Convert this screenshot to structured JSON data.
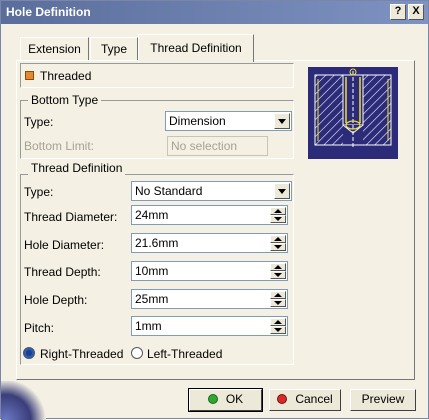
{
  "window": {
    "title": "Hole Definition",
    "help_label": "?",
    "close_label": "X"
  },
  "tabs": [
    {
      "label": "Extension"
    },
    {
      "label": "Type"
    },
    {
      "label": "Thread Definition"
    }
  ],
  "threaded": {
    "label": "Threaded",
    "checked": true
  },
  "bottom_type": {
    "title": "Bottom Type",
    "type_label": "Type:",
    "type_value": "Dimension",
    "limit_label": "Bottom Limit:",
    "limit_value": "No selection"
  },
  "thread_definition": {
    "title": "Thread Definition",
    "type_label": "Type:",
    "type_value": "No Standard",
    "fields": [
      {
        "label": "Thread Diameter:",
        "value": "24mm"
      },
      {
        "label": "Hole Diameter:",
        "value": "21.6mm"
      },
      {
        "label": "Thread Depth:",
        "value": "10mm"
      },
      {
        "label": "Hole Depth:",
        "value": "25mm"
      },
      {
        "label": "Pitch:",
        "value": "1mm"
      }
    ],
    "right_threaded_label": "Right-Threaded",
    "left_threaded_label": "Left-Threaded",
    "selected_direction": "Right-Threaded"
  },
  "buttons": {
    "ok": "OK",
    "cancel": "Cancel",
    "preview": "Preview"
  },
  "colors": {
    "titlebar": "#5a6d9b",
    "dialog_bg": "#f4f0e3",
    "preview_bg": "#2b2b7a",
    "ok_dot": "#2ea82e",
    "cancel_dot": "#d62a2a"
  }
}
